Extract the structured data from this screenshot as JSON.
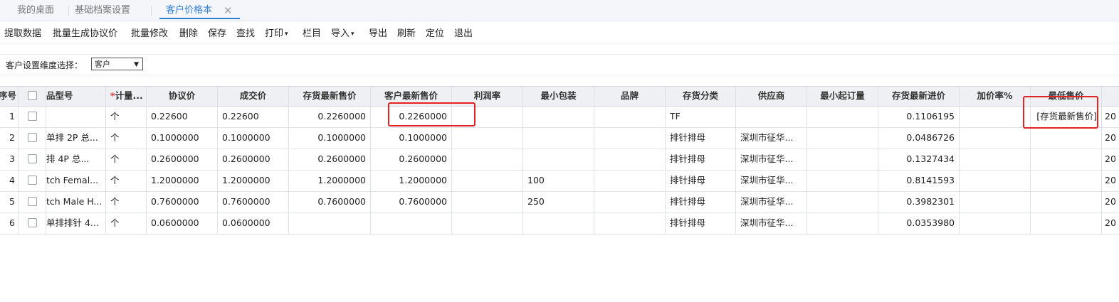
{
  "tabs": [
    {
      "label": "我的桌面"
    },
    {
      "label": "基础档案设置"
    },
    {
      "label": "客户价格本",
      "close": "✕"
    }
  ],
  "toolbar": {
    "items": [
      "提取数据",
      "批量生成协议价",
      "批量修改",
      "删除",
      "保存",
      "查找",
      "打印",
      "栏目",
      "导入",
      "导出",
      "刷新",
      "定位",
      "退出"
    ],
    "caret": "▾"
  },
  "filter": {
    "label": "客户设置维度选择：",
    "value": "客户",
    "arrow": "▼"
  },
  "table": {
    "headers": [
      "序号",
      "",
      "品型号",
      "计量...",
      "协议价",
      "成交价",
      "存货最新售价",
      "客户最新售价",
      "利润率",
      "最小包装",
      "品牌",
      "存货分类",
      "供应商",
      "最小起订量",
      "存货最新进价",
      "加价率%",
      "最低售价",
      ""
    ],
    "required_mark": "*",
    "rows": [
      [
        "1",
        "",
        "",
        "个",
        "0.22600",
        "0.22600",
        "0.2260000",
        "0.2260000",
        "",
        "",
        "",
        "TF",
        "",
        "",
        "0.1106195",
        "",
        "[存货最新售价]",
        "20"
      ],
      [
        "2",
        "",
        "单排 2P 总...",
        "个",
        "0.1000000",
        "0.1000000",
        "0.1000000",
        "0.1000000",
        "",
        "",
        "",
        "排针排母",
        "深圳市征华...",
        "",
        "0.0486726",
        "",
        "",
        "20"
      ],
      [
        "3",
        "",
        "排 4P 总...",
        "个",
        "0.2600000",
        "0.2600000",
        "0.2600000",
        "0.2600000",
        "",
        "",
        "",
        "排针排母",
        "深圳市征华...",
        "",
        "0.1327434",
        "",
        "",
        "20"
      ],
      [
        "4",
        "",
        "tch Femal...",
        "个",
        "1.2000000",
        "1.2000000",
        "1.2000000",
        "1.2000000",
        "",
        "100",
        "",
        "排针排母",
        "深圳市征华...",
        "",
        "0.8141593",
        "",
        "",
        "20"
      ],
      [
        "5",
        "",
        "tch Male H...",
        "个",
        "0.7600000",
        "0.7600000",
        "0.7600000",
        "0.7600000",
        "",
        "250",
        "",
        "排针排母",
        "深圳市征华...",
        "",
        "0.3982301",
        "",
        "",
        "20"
      ],
      [
        "6",
        "",
        "单排排针 4...",
        "个",
        "0.0600000",
        "0.0600000",
        "",
        "",
        "",
        "",
        "",
        "排针排母",
        "深圳市征华...",
        "",
        "0.0353980",
        "",
        "",
        "20"
      ]
    ]
  }
}
